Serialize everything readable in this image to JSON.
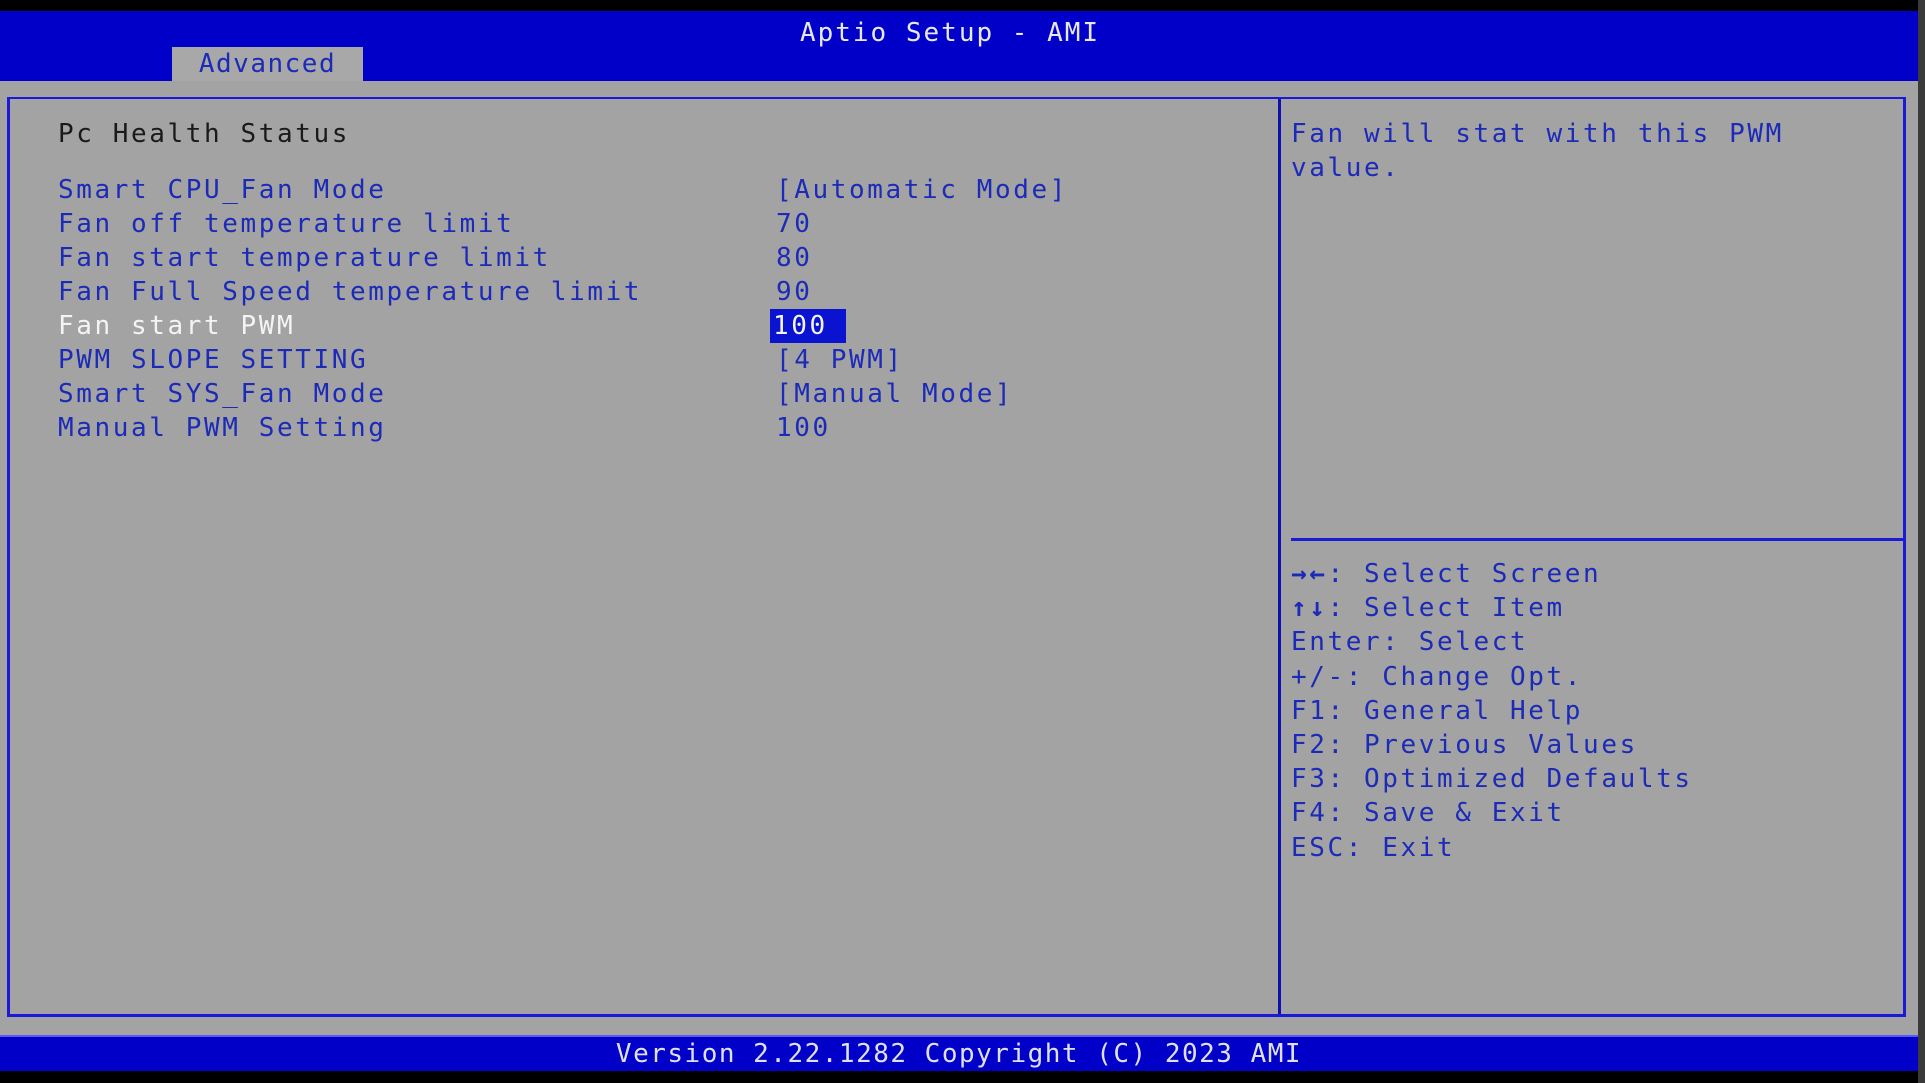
{
  "header": {
    "title": "Aptio Setup - AMI",
    "tabs": [
      {
        "label": "Advanced",
        "active": true
      }
    ]
  },
  "page": {
    "section_title": "Pc Health Status",
    "items": [
      {
        "label": "Smart CPU_Fan Mode",
        "value": "[Automatic Mode]",
        "selected": false
      },
      {
        "label": "Fan off temperature limit",
        "value": "70",
        "selected": false
      },
      {
        "label": "Fan start temperature limit",
        "value": "80",
        "selected": false
      },
      {
        "label": "Fan Full Speed temperature limit",
        "value": "90",
        "selected": false
      },
      {
        "label": "Fan start PWM",
        "value": "100",
        "selected": true
      },
      {
        "label": "PWM SLOPE SETTING",
        "value": "[4 PWM]",
        "selected": false
      },
      {
        "label": "Smart SYS_Fan Mode",
        "value": "[Manual Mode]",
        "selected": false
      },
      {
        "label": "Manual PWM Setting",
        "value": "100",
        "selected": false
      }
    ]
  },
  "help": {
    "text": "Fan will stat with this PWM value."
  },
  "keys": [
    {
      "key": "→←",
      "desc": ": Select Screen",
      "icon": "left-right-arrows-icon"
    },
    {
      "key": "↑↓",
      "desc": ": Select Item",
      "icon": "up-down-arrows-icon"
    },
    {
      "key": "Enter",
      "desc": ": Select"
    },
    {
      "key": "+/-",
      "desc": ": Change Opt."
    },
    {
      "key": "F1",
      "desc": ": General Help"
    },
    {
      "key": "F2",
      "desc": ": Previous Values"
    },
    {
      "key": "F3",
      "desc": ": Optimized Defaults"
    },
    {
      "key": "F4",
      "desc": ": Save & Exit"
    },
    {
      "key": "ESC",
      "desc": ": Exit"
    }
  ],
  "footer": {
    "text": "Version 2.22.1282 Copyright (C) 2023 AMI"
  },
  "colors": {
    "header_blue": "#0000c8",
    "panel_gray": "#a3a3a3",
    "text_blue": "#1c2ab8",
    "selected_bg": "#0a14d0",
    "selected_text": "#f4f4f4"
  }
}
